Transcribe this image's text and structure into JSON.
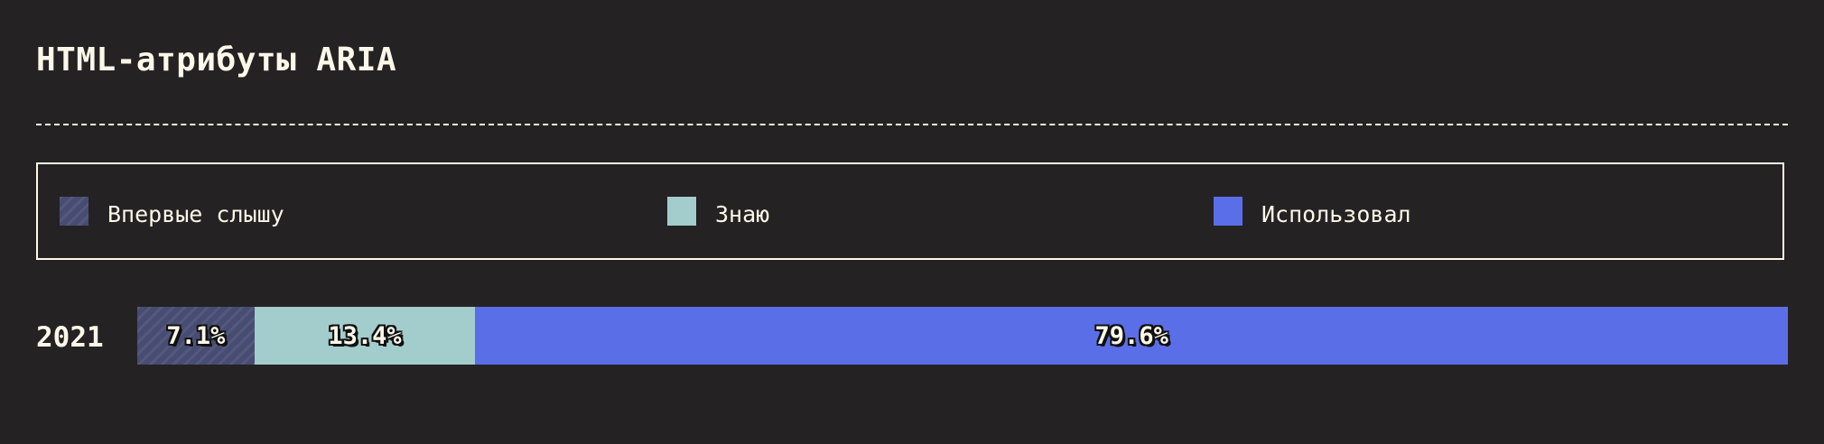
{
  "chart_data": {
    "type": "bar",
    "orientation": "horizontal",
    "stacked": true,
    "normalized": true,
    "title": "HTML-атрибуты ARIA",
    "categories": [
      "2021"
    ],
    "series": [
      {
        "name": "Впервые слышу",
        "values": [
          7.1
        ],
        "label": "7.1%",
        "color": "#474c72",
        "pattern": "hatch"
      },
      {
        "name": "Знаю",
        "values": [
          13.4
        ],
        "label": "13.4%",
        "color": "#a3cccc"
      },
      {
        "name": "Использовал",
        "values": [
          79.6
        ],
        "label": "79.6%",
        "color": "#5a6fe7"
      }
    ],
    "xlim": [
      0,
      100
    ],
    "unit": "%",
    "legend_position": "top",
    "grid": false
  },
  "colors": {
    "background": "#252224",
    "foreground": "#fbf8e9"
  }
}
